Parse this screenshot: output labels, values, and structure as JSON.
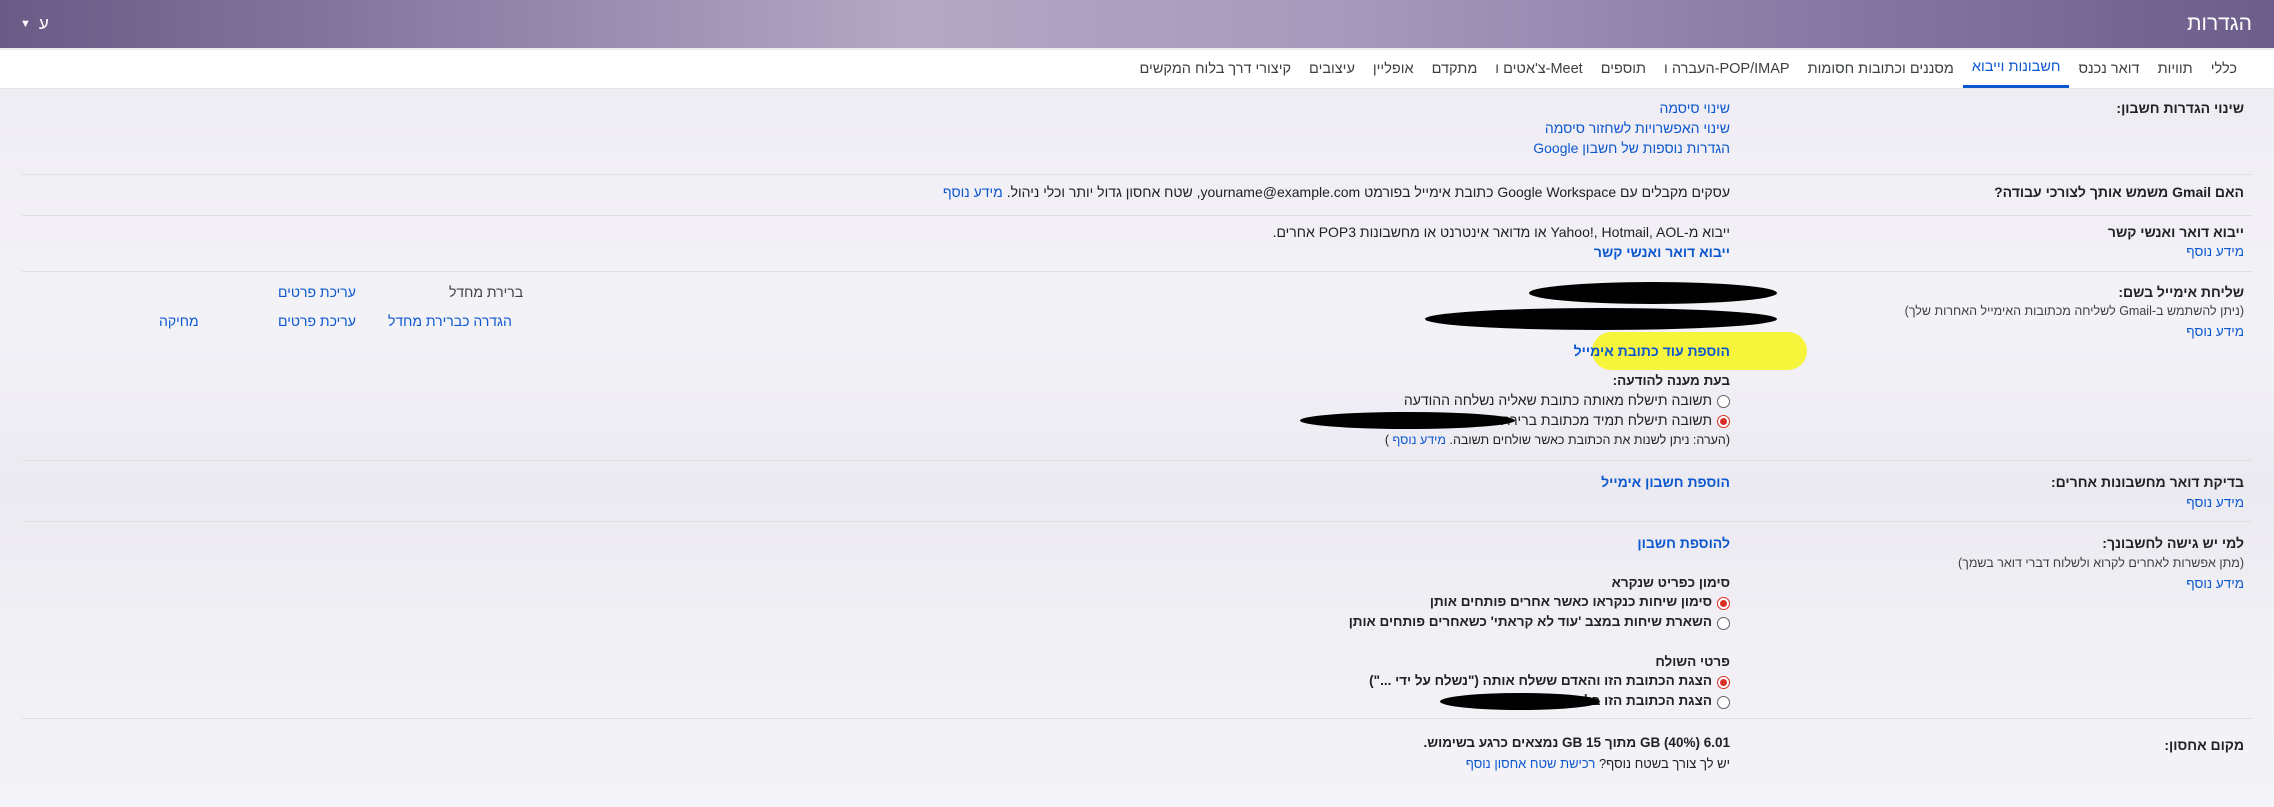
{
  "header": {
    "title": "הגדרות",
    "input_tool": "ע"
  },
  "tabs": [
    {
      "label": "כללי"
    },
    {
      "label": "תוויות"
    },
    {
      "label": "דואר נכנס"
    },
    {
      "label": "חשבונות וייבוא"
    },
    {
      "label": "מסננים וכתובות חסומות"
    },
    {
      "label": "העברה ו-POP/IMAP"
    },
    {
      "label": "תוספים"
    },
    {
      "label": "צ'אטים ו-Meet"
    },
    {
      "label": "מתקדם"
    },
    {
      "label": "אופליין"
    },
    {
      "label": "עיצובים"
    },
    {
      "label": "קיצורי דרך בלוח המקשים"
    }
  ],
  "change_account": {
    "label": "שינוי הגדרות חשבון:",
    "links": [
      "שינוי סיסמה",
      "שינוי האפשרויות לשחזור סיסמה",
      "הגדרות נוספות של חשבון Google"
    ]
  },
  "workspace": {
    "label": "האם Gmail משמש אותך לצורכי עבודה?",
    "text": "עסקים מקבלים עם Google Workspace כתובת אימייל בפורמט yourname@example.com, שטח אחסון גדול יותר וכלי ניהול.",
    "more": "מידע נוסף"
  },
  "import": {
    "label": "ייבוא דואר ואנשי קשר",
    "more": "מידע נוסף",
    "text": "ייבוא מ-Yahoo!, Hotmail, AOL או מדואר אינטרנט או מחשבונות POP3 אחרים.",
    "action": "ייבוא דואר ואנשי קשר"
  },
  "send_as": {
    "label": "שליחת אימייל בשם:",
    "sub": "(ניתן להשתמש ב-Gmail לשליחה מכתובות האימייל האחרות שלך)",
    "more": "מידע נוסף",
    "row1": {
      "status": "ברירת מחדל",
      "edit": "עריכת פרטים"
    },
    "row2": {
      "make_default": "הגדרה כברירת מחדל",
      "edit": "עריכת פרטים",
      "delete": "מחיקה"
    },
    "add": "הוספת עוד כתובת אימייל",
    "reply_label": "בעת מענה להודעה:",
    "opt1": "תשובה תישלח מאותה כתובת שאליה נשלחה ההודעה",
    "opt2": "תשובה תישלח תמיד מכתובת ברירת המחדל",
    "note_text": "(הערה: ניתן לשנות את הכתובת כאשר שולחים תשובה.",
    "note_more": "מידע נוסף",
    "note_close": ")"
  },
  "check_mail": {
    "label": "בדיקת דואר מחשבונות אחרים:",
    "more": "מידע נוסף",
    "action": "הוספת חשבון אימייל"
  },
  "grant": {
    "label": "למי יש גישה לחשבונך:",
    "sub": "(מתן אפשרות לאחרים לקרוא ולשלוח דברי דואר בשמך)",
    "more": "מידע נוסף",
    "action": "להוספת חשבון",
    "mark_title": "סימון כפריט שנקרא",
    "mark_opt1": "סימון שיחות כנקראו כאשר אחרים פותחים אותן",
    "mark_opt2": "השארת שיחות במצב 'עוד לא קראתי' כשאחרים פותחים אותן",
    "sender_title": "פרטי השולח",
    "sender_opt1": "הצגת הכתובת הזו והאדם ששלח אותה (\"נשלח על ידי ...\")",
    "sender_opt2": "הצגת הכתובת הזו בלבד"
  },
  "storage": {
    "label": "מקום אחסון:",
    "usage": "6.01 GB (40%) מתוך 15 GB נמצאים כרגע בשימוש.",
    "question": "יש לך צורך בשטח נוסף?",
    "buy": "רכישת שטח אחסון נוסף"
  }
}
